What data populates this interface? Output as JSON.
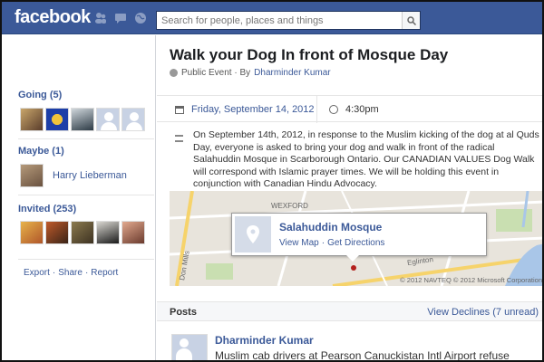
{
  "header": {
    "logo": "facebook",
    "search_placeholder": "Search for people, places and things"
  },
  "sidebar": {
    "going_label": "Going (5)",
    "maybe_label": "Maybe (1)",
    "maybe_name": "Harry Lieberman",
    "invited_label": "Invited (253)",
    "footer": {
      "export": "Export",
      "share": "Share",
      "report": "Report",
      "sep": "·"
    }
  },
  "event": {
    "title": "Walk your Dog In front of Mosque Day",
    "visibility": "Public Event · By ",
    "host": "Dharminder Kumar",
    "date": "Friday, September 14, 2012",
    "time": "4:30pm",
    "description": "On September 14th, 2012, in response to the Muslim kicking of the dog at al Quds Day, everyone is asked to bring your dog and walk in front of the radical Salahuddin Mosque in Scarborough Ontario. Our CANADIAN VALUES Dog Walk will correspond with Islamic prayer times. We will be holding this event in conjunction with Canadian Hindu Advocacy."
  },
  "map": {
    "place_name": "Salahuddin Mosque",
    "view_map": "View Map",
    "get_directions": "Get Directions",
    "sep": "·",
    "streets": {
      "wexford": "WEXFORD",
      "eglinton": "Eglinton",
      "dom_mills": "Don Mills"
    },
    "copyright": "© 2012 NAVTEQ © 2012 Microsoft Corporation"
  },
  "posts": {
    "title": "Posts",
    "declines_link": "View Declines (7 unread)",
    "author": "Dharminder Kumar",
    "text": "Muslim cab drivers at Pearson Canuckistan Intl Airport refuse"
  },
  "colors": {
    "brand": "#3b5998",
    "link": "#3b5998"
  }
}
